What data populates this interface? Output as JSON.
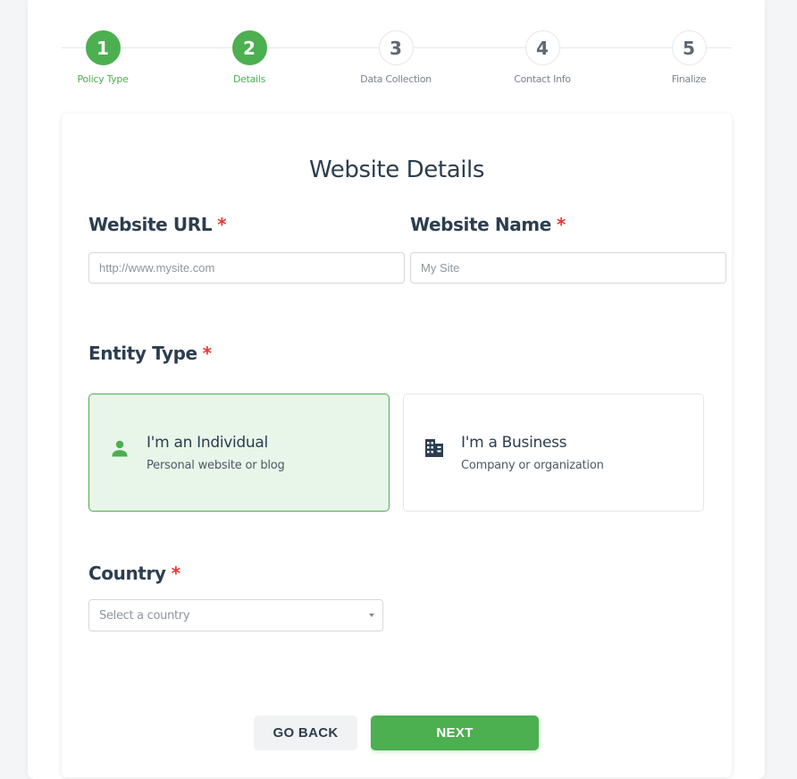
{
  "stepper": {
    "steps": [
      {
        "number": "1",
        "label": "Policy Type",
        "state": "complete"
      },
      {
        "number": "2",
        "label": "Details",
        "state": "current"
      },
      {
        "number": "3",
        "label": "Data Collection",
        "state": "upcoming"
      },
      {
        "number": "4",
        "label": "Contact Info",
        "state": "upcoming"
      },
      {
        "number": "5",
        "label": "Finalize",
        "state": "upcoming"
      }
    ]
  },
  "form": {
    "title": "Website Details",
    "required_marker": "*",
    "website_url": {
      "label": "Website URL",
      "placeholder": "http://www.mysite.com",
      "value": ""
    },
    "website_name": {
      "label": "Website Name",
      "placeholder": "My Site",
      "value": ""
    },
    "entity_type": {
      "label": "Entity Type",
      "selected": "individual",
      "options": [
        {
          "id": "individual",
          "title": "I'm an Individual",
          "subtitle": "Personal website or blog",
          "icon": "person-icon"
        },
        {
          "id": "business",
          "title": "I'm a Business",
          "subtitle": "Company or organization",
          "icon": "building-icon"
        }
      ]
    },
    "country": {
      "label": "Country",
      "placeholder": "Select a country",
      "value": ""
    }
  },
  "actions": {
    "back_label": "GO BACK",
    "next_label": "NEXT"
  },
  "colors": {
    "accent": "#4caf50",
    "selected_bg": "#e8f5e9",
    "required": "#e53935",
    "text": "#2c3e50"
  }
}
